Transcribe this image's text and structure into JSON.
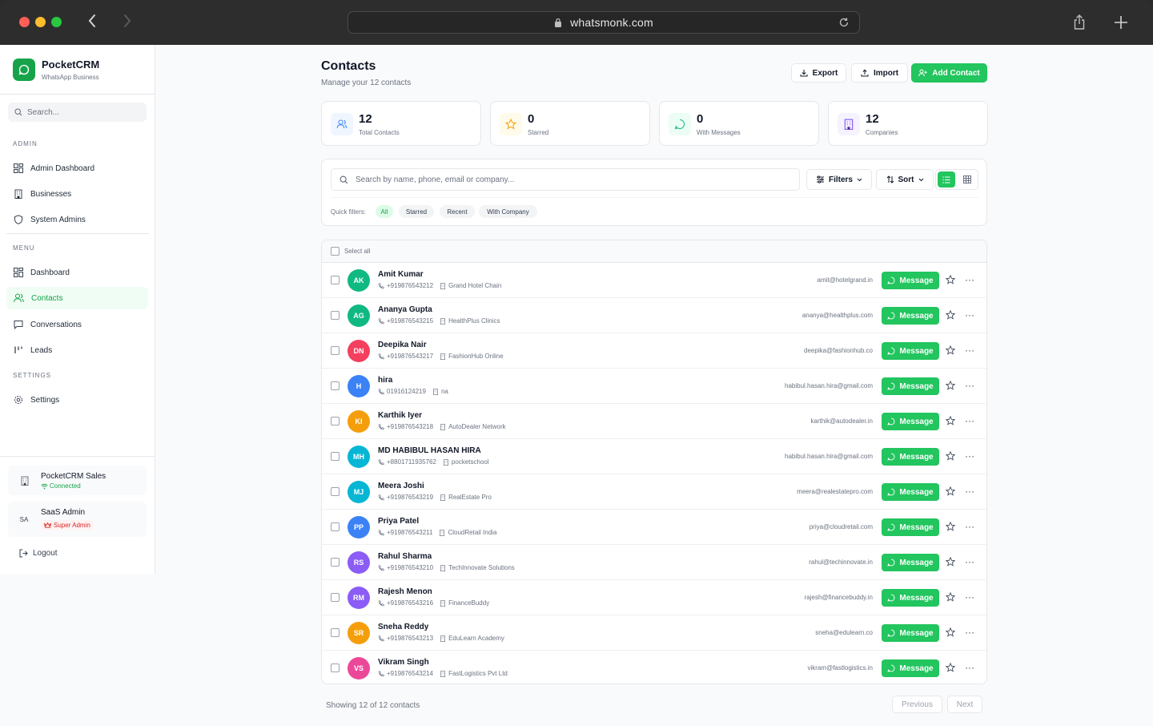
{
  "browser": {
    "url": "whatsmonk.com"
  },
  "brand": {
    "title": "PocketCRM",
    "subtitle": "WhatsApp Business"
  },
  "sidebar": {
    "search_placeholder": "Search...",
    "sections": {
      "admin": "ADMIN",
      "menu": "MENU",
      "settings": "SETTINGS"
    },
    "admin_items": [
      "Admin Dashboard",
      "Businesses",
      "System Admins"
    ],
    "menu_items": [
      "Dashboard",
      "Contacts",
      "Conversations",
      "Leads"
    ],
    "settings_items": [
      "Settings"
    ],
    "business": {
      "name": "PocketCRM Sales",
      "status": "Connected"
    },
    "user": {
      "initials": "SA",
      "name": "SaaS Admin",
      "role": "Super Admin"
    },
    "logout": "Logout"
  },
  "header": {
    "title": "Contacts",
    "subtitle": "Manage your 12 contacts",
    "export": "Export",
    "import": "Import",
    "add": "Add Contact"
  },
  "stats": [
    {
      "value": "12",
      "label": "Total Contacts"
    },
    {
      "value": "0",
      "label": "Starred"
    },
    {
      "value": "0",
      "label": "With Messages"
    },
    {
      "value": "12",
      "label": "Companies"
    }
  ],
  "filters": {
    "search_placeholder": "Search by name, phone, email or company...",
    "filters_label": "Filters",
    "sort_label": "Sort",
    "quick_label": "Quick filters:",
    "chips": [
      "All",
      "Starred",
      "Recent",
      "With Company"
    ]
  },
  "list": {
    "select_all": "Select all",
    "message_label": "Message",
    "contacts": [
      {
        "initials": "AK",
        "name": "Amit Kumar",
        "phone": "+919876543212",
        "company": "Grand Hotel Chain",
        "email": "amit@hotelgrand.in",
        "color": "#10b981"
      },
      {
        "initials": "AG",
        "name": "Ananya Gupta",
        "phone": "+919876543215",
        "company": "HealthPlus Clinics",
        "email": "ananya@healthplus.com",
        "color": "#10b981"
      },
      {
        "initials": "DN",
        "name": "Deepika Nair",
        "phone": "+919876543217",
        "company": "FashionHub Online",
        "email": "deepika@fashionhub.co",
        "color": "#f43f5e"
      },
      {
        "initials": "H",
        "name": "hira",
        "phone": "01916124219",
        "company": "na",
        "email": "habibul.hasan.hira@gmail.com",
        "color": "#3b82f6"
      },
      {
        "initials": "KI",
        "name": "Karthik Iyer",
        "phone": "+919876543218",
        "company": "AutoDealer Network",
        "email": "karthik@autodealer.in",
        "color": "#f59e0b"
      },
      {
        "initials": "MH",
        "name": "MD HABIBUL HASAN HIRA",
        "phone": "+8801711935762",
        "company": "pocketschool",
        "email": "habibul.hasan.hira@gmail.com",
        "color": "#06b6d4"
      },
      {
        "initials": "MJ",
        "name": "Meera Joshi",
        "phone": "+919876543219",
        "company": "RealEstate Pro",
        "email": "meera@realestatepro.com",
        "color": "#06b6d4"
      },
      {
        "initials": "PP",
        "name": "Priya Patel",
        "phone": "+919876543211",
        "company": "CloudRetail India",
        "email": "priya@cloudretail.com",
        "color": "#3b82f6"
      },
      {
        "initials": "RS",
        "name": "Rahul Sharma",
        "phone": "+919876543210",
        "company": "TechInnovate Solutions",
        "email": "rahul@techinnovate.in",
        "color": "#8b5cf6"
      },
      {
        "initials": "RM",
        "name": "Rajesh Menon",
        "phone": "+919876543216",
        "company": "FinanceBuddy",
        "email": "rajesh@financebuddy.in",
        "color": "#8b5cf6"
      },
      {
        "initials": "SR",
        "name": "Sneha Reddy",
        "phone": "+919876543213",
        "company": "EduLearn Academy",
        "email": "sneha@edulearn.co",
        "color": "#f59e0b"
      },
      {
        "initials": "VS",
        "name": "Vikram Singh",
        "phone": "+919876543214",
        "company": "FastLogistics Pvt Ltd",
        "email": "vikram@fastlogistics.in",
        "color": "#ec4899"
      }
    ]
  },
  "footer": {
    "showing": "Showing 12 of 12 contacts",
    "previous": "Previous",
    "next": "Next"
  }
}
